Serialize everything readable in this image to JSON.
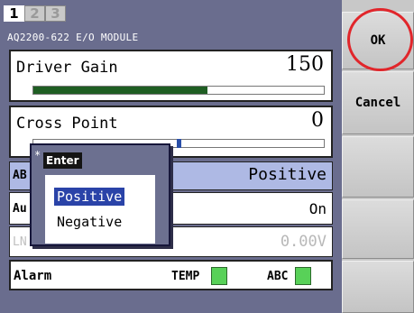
{
  "tabs": [
    "1",
    "2",
    "3"
  ],
  "active_tab": 0,
  "module_title": "AQ2200-622 E/O MODULE",
  "driver_gain": {
    "label": "Driver Gain",
    "value": "150",
    "bar_fraction": 0.6
  },
  "cross_point": {
    "label": "Cross Point",
    "value": "0",
    "marker_fraction": 0.5
  },
  "rows": {
    "abc": {
      "label": "AB",
      "value": "Positive"
    },
    "auto": {
      "label": "Au",
      "value": "On"
    },
    "ln": {
      "label": "LN",
      "value": "0.00V"
    },
    "alarm": {
      "label": "Alarm",
      "temp_label": "TEMP",
      "abc_label": "ABC"
    }
  },
  "popup": {
    "marker": "*",
    "title": "Enter",
    "options": [
      "Positive",
      "Negative"
    ],
    "selected": "Positive"
  },
  "side_buttons": {
    "ok": "OK",
    "cancel": "Cancel"
  },
  "colors": {
    "gain_fill": "#1f5e23",
    "indicator_green": "#58d158",
    "selection_blue": "#2a43a8",
    "highlight_ring": "#e1262b"
  }
}
